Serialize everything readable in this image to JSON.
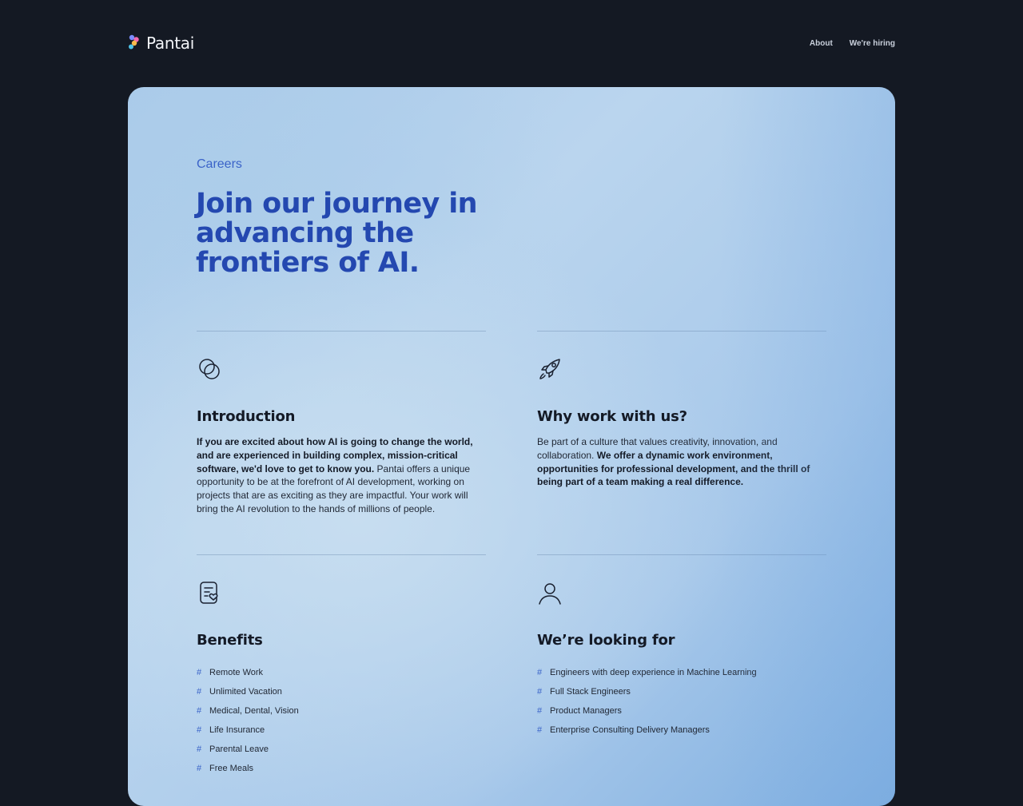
{
  "header": {
    "brand": "Pantai",
    "nav": [
      {
        "label": "About"
      },
      {
        "label": "We're hiring"
      }
    ]
  },
  "hero": {
    "eyebrow": "Careers",
    "headline": "Join our journey in advancing the frontiers of AI."
  },
  "sections": {
    "introduction": {
      "title": "Introduction",
      "icon": "overlapping-circles-icon",
      "body_bold": "If you are excited about how AI is going to change the world, and are experienced in building complex, mission-critical software, we'd love to get to know you.",
      "body_rest": " Pantai offers a unique opportunity to be at the forefront of AI development, working on projects that are as exciting as they are impactful. Your work will bring the AI revolution to the hands of millions of people."
    },
    "why": {
      "title": "Why work with us?",
      "icon": "rocket-icon",
      "body_lead": "Be part of a culture that values creativity, innovation, and collaboration. ",
      "body_bold": "We offer a dynamic work environment, opportunities for professional development, and the thrill of being part of a team making a real difference."
    },
    "benefits": {
      "title": "Benefits",
      "icon": "document-heart-icon",
      "items": [
        "Remote Work",
        "Unlimited Vacation",
        "Medical, Dental, Vision",
        "Life Insurance",
        "Parental Leave",
        "Free Meals"
      ]
    },
    "looking_for": {
      "title": "We’re looking for",
      "icon": "user-icon",
      "items": [
        "Engineers with deep experience in Machine Learning",
        "Full Stack Engineers",
        "Product Managers",
        "Enterprise Consulting Delivery Managers"
      ]
    }
  },
  "colors": {
    "page_bg": "#141923",
    "accent": "#2448b0",
    "eyebrow": "#3a63c8"
  }
}
